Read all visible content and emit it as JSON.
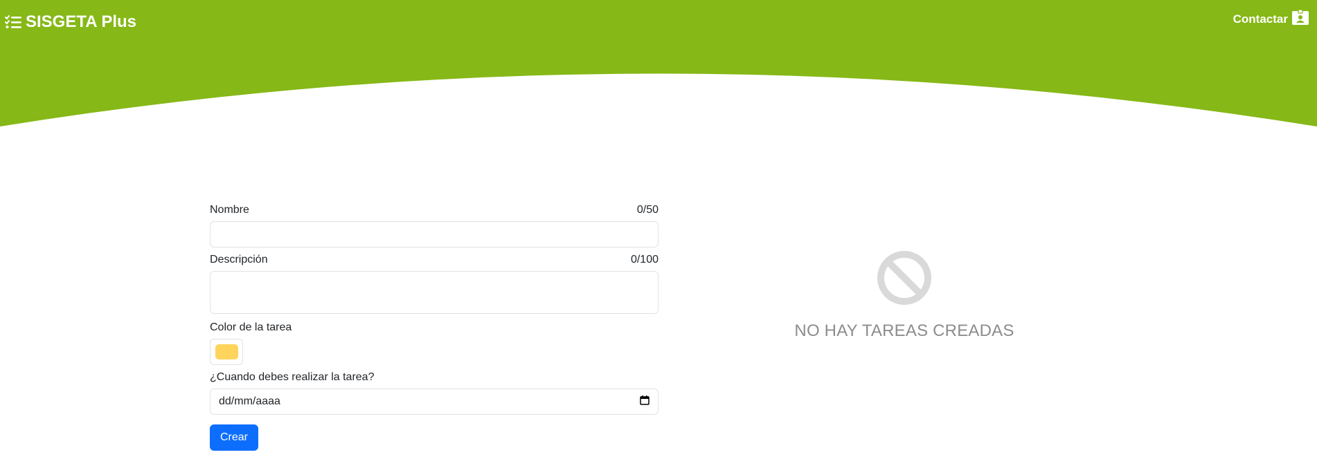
{
  "header": {
    "brand_name": "SISGETA Plus",
    "brand_icon": "checklist-icon",
    "contact_label": "Contactar",
    "contact_icon": "contact-card-icon",
    "brand_color": "#86B817"
  },
  "form": {
    "name_label": "Nombre",
    "name_counter": "0/50",
    "name_value": "",
    "description_label": "Descripción",
    "description_counter": "0/100",
    "description_value": "",
    "color_label": "Color de la tarea",
    "color_value": "#FFD45C",
    "date_label": "¿Cuando debes realizar la tarea?",
    "date_placeholder": "dd/mm/aaaa",
    "calendar_icon": "calendar-icon",
    "submit_label": "Crear",
    "submit_color": "#0D6EFD"
  },
  "empty_state": {
    "icon": "prohibited-icon",
    "message": "NO HAY TAREAS CREADAS"
  }
}
